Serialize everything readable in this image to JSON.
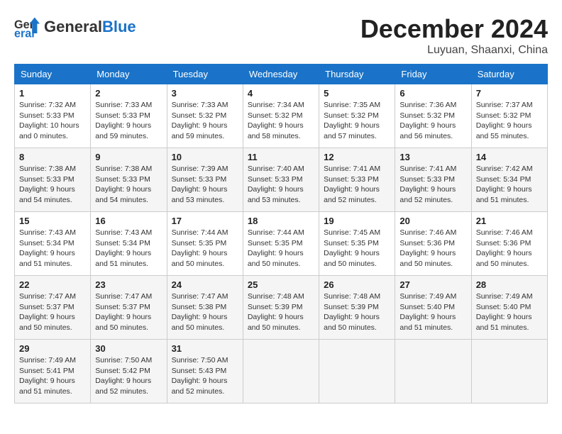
{
  "header": {
    "logo_general": "General",
    "logo_blue": "Blue",
    "month_title": "December 2024",
    "location": "Luyuan, Shaanxi, China"
  },
  "days_of_week": [
    "Sunday",
    "Monday",
    "Tuesday",
    "Wednesday",
    "Thursday",
    "Friday",
    "Saturday"
  ],
  "weeks": [
    [
      {
        "day": "1",
        "sunrise": "7:32 AM",
        "sunset": "5:33 PM",
        "daylight": "10 hours and 0 minutes."
      },
      {
        "day": "2",
        "sunrise": "7:33 AM",
        "sunset": "5:33 PM",
        "daylight": "9 hours and 59 minutes."
      },
      {
        "day": "3",
        "sunrise": "7:33 AM",
        "sunset": "5:32 PM",
        "daylight": "9 hours and 59 minutes."
      },
      {
        "day": "4",
        "sunrise": "7:34 AM",
        "sunset": "5:32 PM",
        "daylight": "9 hours and 58 minutes."
      },
      {
        "day": "5",
        "sunrise": "7:35 AM",
        "sunset": "5:32 PM",
        "daylight": "9 hours and 57 minutes."
      },
      {
        "day": "6",
        "sunrise": "7:36 AM",
        "sunset": "5:32 PM",
        "daylight": "9 hours and 56 minutes."
      },
      {
        "day": "7",
        "sunrise": "7:37 AM",
        "sunset": "5:32 PM",
        "daylight": "9 hours and 55 minutes."
      }
    ],
    [
      {
        "day": "8",
        "sunrise": "7:38 AM",
        "sunset": "5:33 PM",
        "daylight": "9 hours and 54 minutes."
      },
      {
        "day": "9",
        "sunrise": "7:38 AM",
        "sunset": "5:33 PM",
        "daylight": "9 hours and 54 minutes."
      },
      {
        "day": "10",
        "sunrise": "7:39 AM",
        "sunset": "5:33 PM",
        "daylight": "9 hours and 53 minutes."
      },
      {
        "day": "11",
        "sunrise": "7:40 AM",
        "sunset": "5:33 PM",
        "daylight": "9 hours and 53 minutes."
      },
      {
        "day": "12",
        "sunrise": "7:41 AM",
        "sunset": "5:33 PM",
        "daylight": "9 hours and 52 minutes."
      },
      {
        "day": "13",
        "sunrise": "7:41 AM",
        "sunset": "5:33 PM",
        "daylight": "9 hours and 52 minutes."
      },
      {
        "day": "14",
        "sunrise": "7:42 AM",
        "sunset": "5:34 PM",
        "daylight": "9 hours and 51 minutes."
      }
    ],
    [
      {
        "day": "15",
        "sunrise": "7:43 AM",
        "sunset": "5:34 PM",
        "daylight": "9 hours and 51 minutes."
      },
      {
        "day": "16",
        "sunrise": "7:43 AM",
        "sunset": "5:34 PM",
        "daylight": "9 hours and 51 minutes."
      },
      {
        "day": "17",
        "sunrise": "7:44 AM",
        "sunset": "5:35 PM",
        "daylight": "9 hours and 50 minutes."
      },
      {
        "day": "18",
        "sunrise": "7:44 AM",
        "sunset": "5:35 PM",
        "daylight": "9 hours and 50 minutes."
      },
      {
        "day": "19",
        "sunrise": "7:45 AM",
        "sunset": "5:35 PM",
        "daylight": "9 hours and 50 minutes."
      },
      {
        "day": "20",
        "sunrise": "7:46 AM",
        "sunset": "5:36 PM",
        "daylight": "9 hours and 50 minutes."
      },
      {
        "day": "21",
        "sunrise": "7:46 AM",
        "sunset": "5:36 PM",
        "daylight": "9 hours and 50 minutes."
      }
    ],
    [
      {
        "day": "22",
        "sunrise": "7:47 AM",
        "sunset": "5:37 PM",
        "daylight": "9 hours and 50 minutes."
      },
      {
        "day": "23",
        "sunrise": "7:47 AM",
        "sunset": "5:37 PM",
        "daylight": "9 hours and 50 minutes."
      },
      {
        "day": "24",
        "sunrise": "7:47 AM",
        "sunset": "5:38 PM",
        "daylight": "9 hours and 50 minutes."
      },
      {
        "day": "25",
        "sunrise": "7:48 AM",
        "sunset": "5:39 PM",
        "daylight": "9 hours and 50 minutes."
      },
      {
        "day": "26",
        "sunrise": "7:48 AM",
        "sunset": "5:39 PM",
        "daylight": "9 hours and 50 minutes."
      },
      {
        "day": "27",
        "sunrise": "7:49 AM",
        "sunset": "5:40 PM",
        "daylight": "9 hours and 51 minutes."
      },
      {
        "day": "28",
        "sunrise": "7:49 AM",
        "sunset": "5:40 PM",
        "daylight": "9 hours and 51 minutes."
      }
    ],
    [
      {
        "day": "29",
        "sunrise": "7:49 AM",
        "sunset": "5:41 PM",
        "daylight": "9 hours and 51 minutes."
      },
      {
        "day": "30",
        "sunrise": "7:50 AM",
        "sunset": "5:42 PM",
        "daylight": "9 hours and 52 minutes."
      },
      {
        "day": "31",
        "sunrise": "7:50 AM",
        "sunset": "5:43 PM",
        "daylight": "9 hours and 52 minutes."
      },
      null,
      null,
      null,
      null
    ]
  ],
  "labels": {
    "sunrise": "Sunrise:",
    "sunset": "Sunset:",
    "daylight": "Daylight:"
  }
}
